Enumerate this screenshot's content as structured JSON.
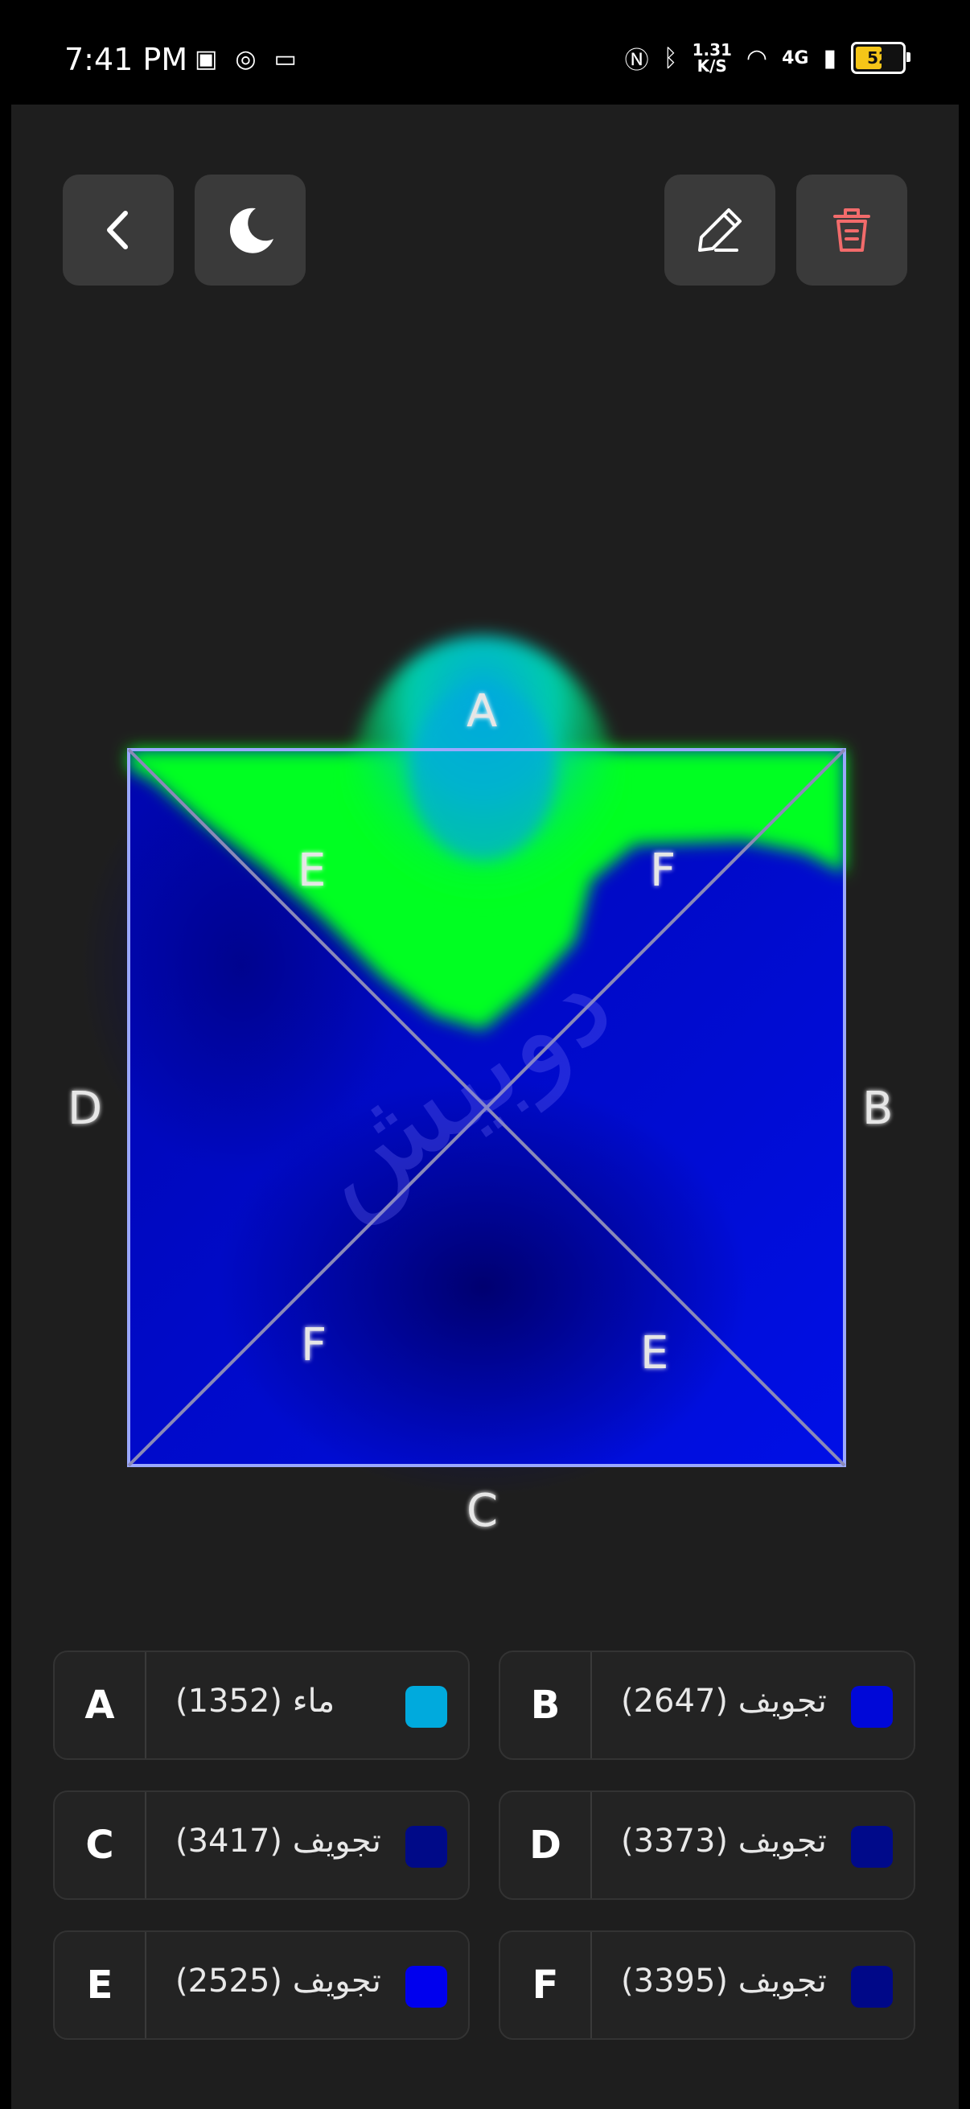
{
  "status": {
    "time": "7:41 PM",
    "net_speed_value": "1.31",
    "net_speed_unit": "K/S",
    "signal": "4G",
    "battery": "52"
  },
  "toolbar": {
    "back_label": "back",
    "theme_label": "dark mode",
    "edit_label": "edit",
    "delete_label": "delete"
  },
  "diagram": {
    "labels": {
      "top": "A",
      "right": "B",
      "bottom": "C",
      "left": "D",
      "upper_left_diag": "E",
      "upper_right_diag": "F",
      "lower_left_diag": "F",
      "lower_right_diag": "E"
    },
    "watermark": "دوبيش",
    "colors": {
      "water": "#00aadd",
      "green": "#00ff22",
      "blue_light": "#0011ff",
      "blue_dark": "#000099"
    }
  },
  "cards": [
    {
      "letter": "A",
      "text": "ماء (1352)",
      "color": "#00aadd"
    },
    {
      "letter": "B",
      "text": "تجويف (2647)",
      "color": "#0008d8"
    },
    {
      "letter": "C",
      "text": "تجويف (3417)",
      "color": "#000a88"
    },
    {
      "letter": "D",
      "text": "تجويف (3373)",
      "color": "#000a8a"
    },
    {
      "letter": "E",
      "text": "تجويف (2525)",
      "color": "#0000ee"
    },
    {
      "letter": "F",
      "text": "تجويف (3395)",
      "color": "#000888"
    }
  ]
}
